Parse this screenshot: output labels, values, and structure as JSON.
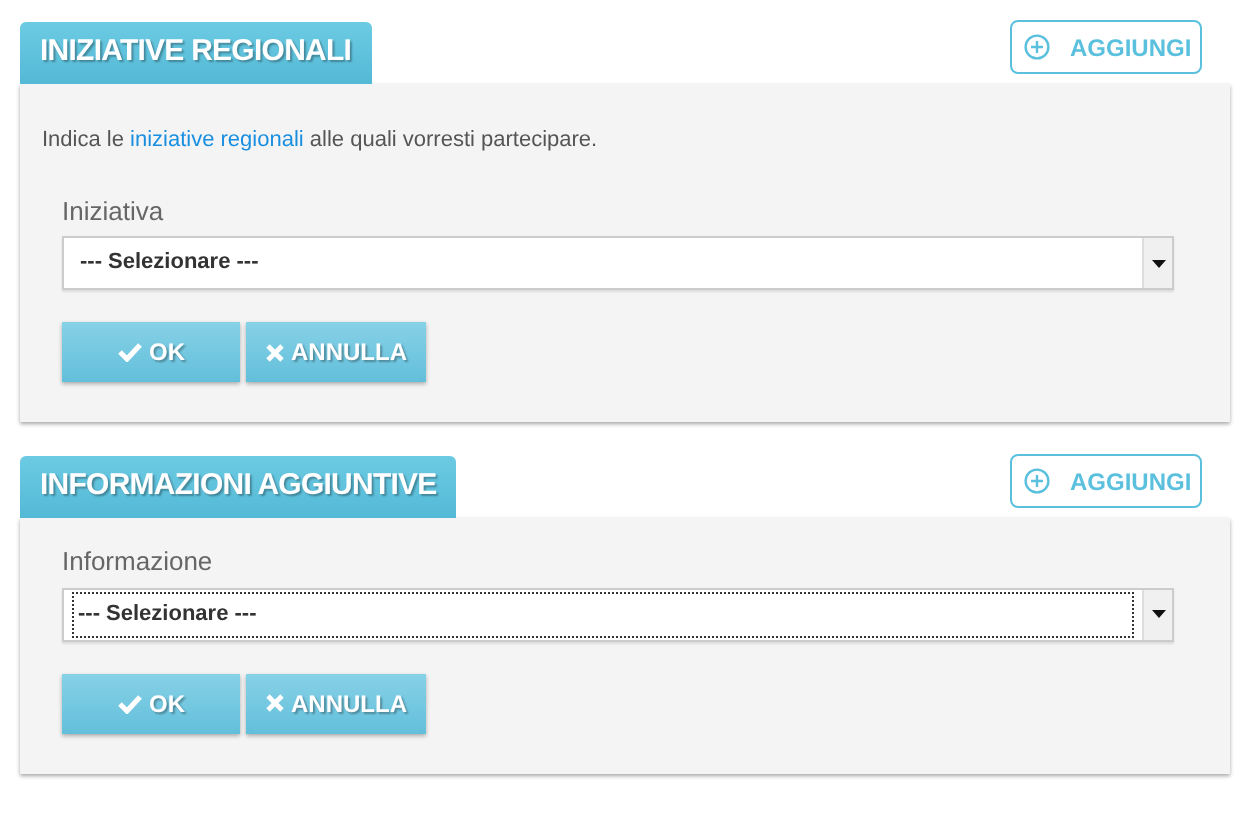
{
  "sections": [
    {
      "title": "INIZIATIVE REGIONALI",
      "add_button": "AGGIUNGI",
      "intro": {
        "before": "Indica le ",
        "link": "iniziative regionali",
        "after": " alle quali vorresti partecipare."
      },
      "field": {
        "label": "Iniziativa",
        "value": "--- Selezionare ---",
        "focused": false
      },
      "buttons": [
        {
          "kind": "ok",
          "label": "OK"
        },
        {
          "kind": "cancel",
          "label": "ANNULLA"
        }
      ]
    },
    {
      "title": "INFORMAZIONI AGGIUNTIVE",
      "add_button": "AGGIUNGI",
      "field": {
        "label": "Informazione",
        "value": "--- Selezionare ---",
        "focused": true
      },
      "buttons": [
        {
          "kind": "ok",
          "label": "OK"
        },
        {
          "kind": "cancel",
          "label": "ANNULLA"
        }
      ]
    }
  ]
}
